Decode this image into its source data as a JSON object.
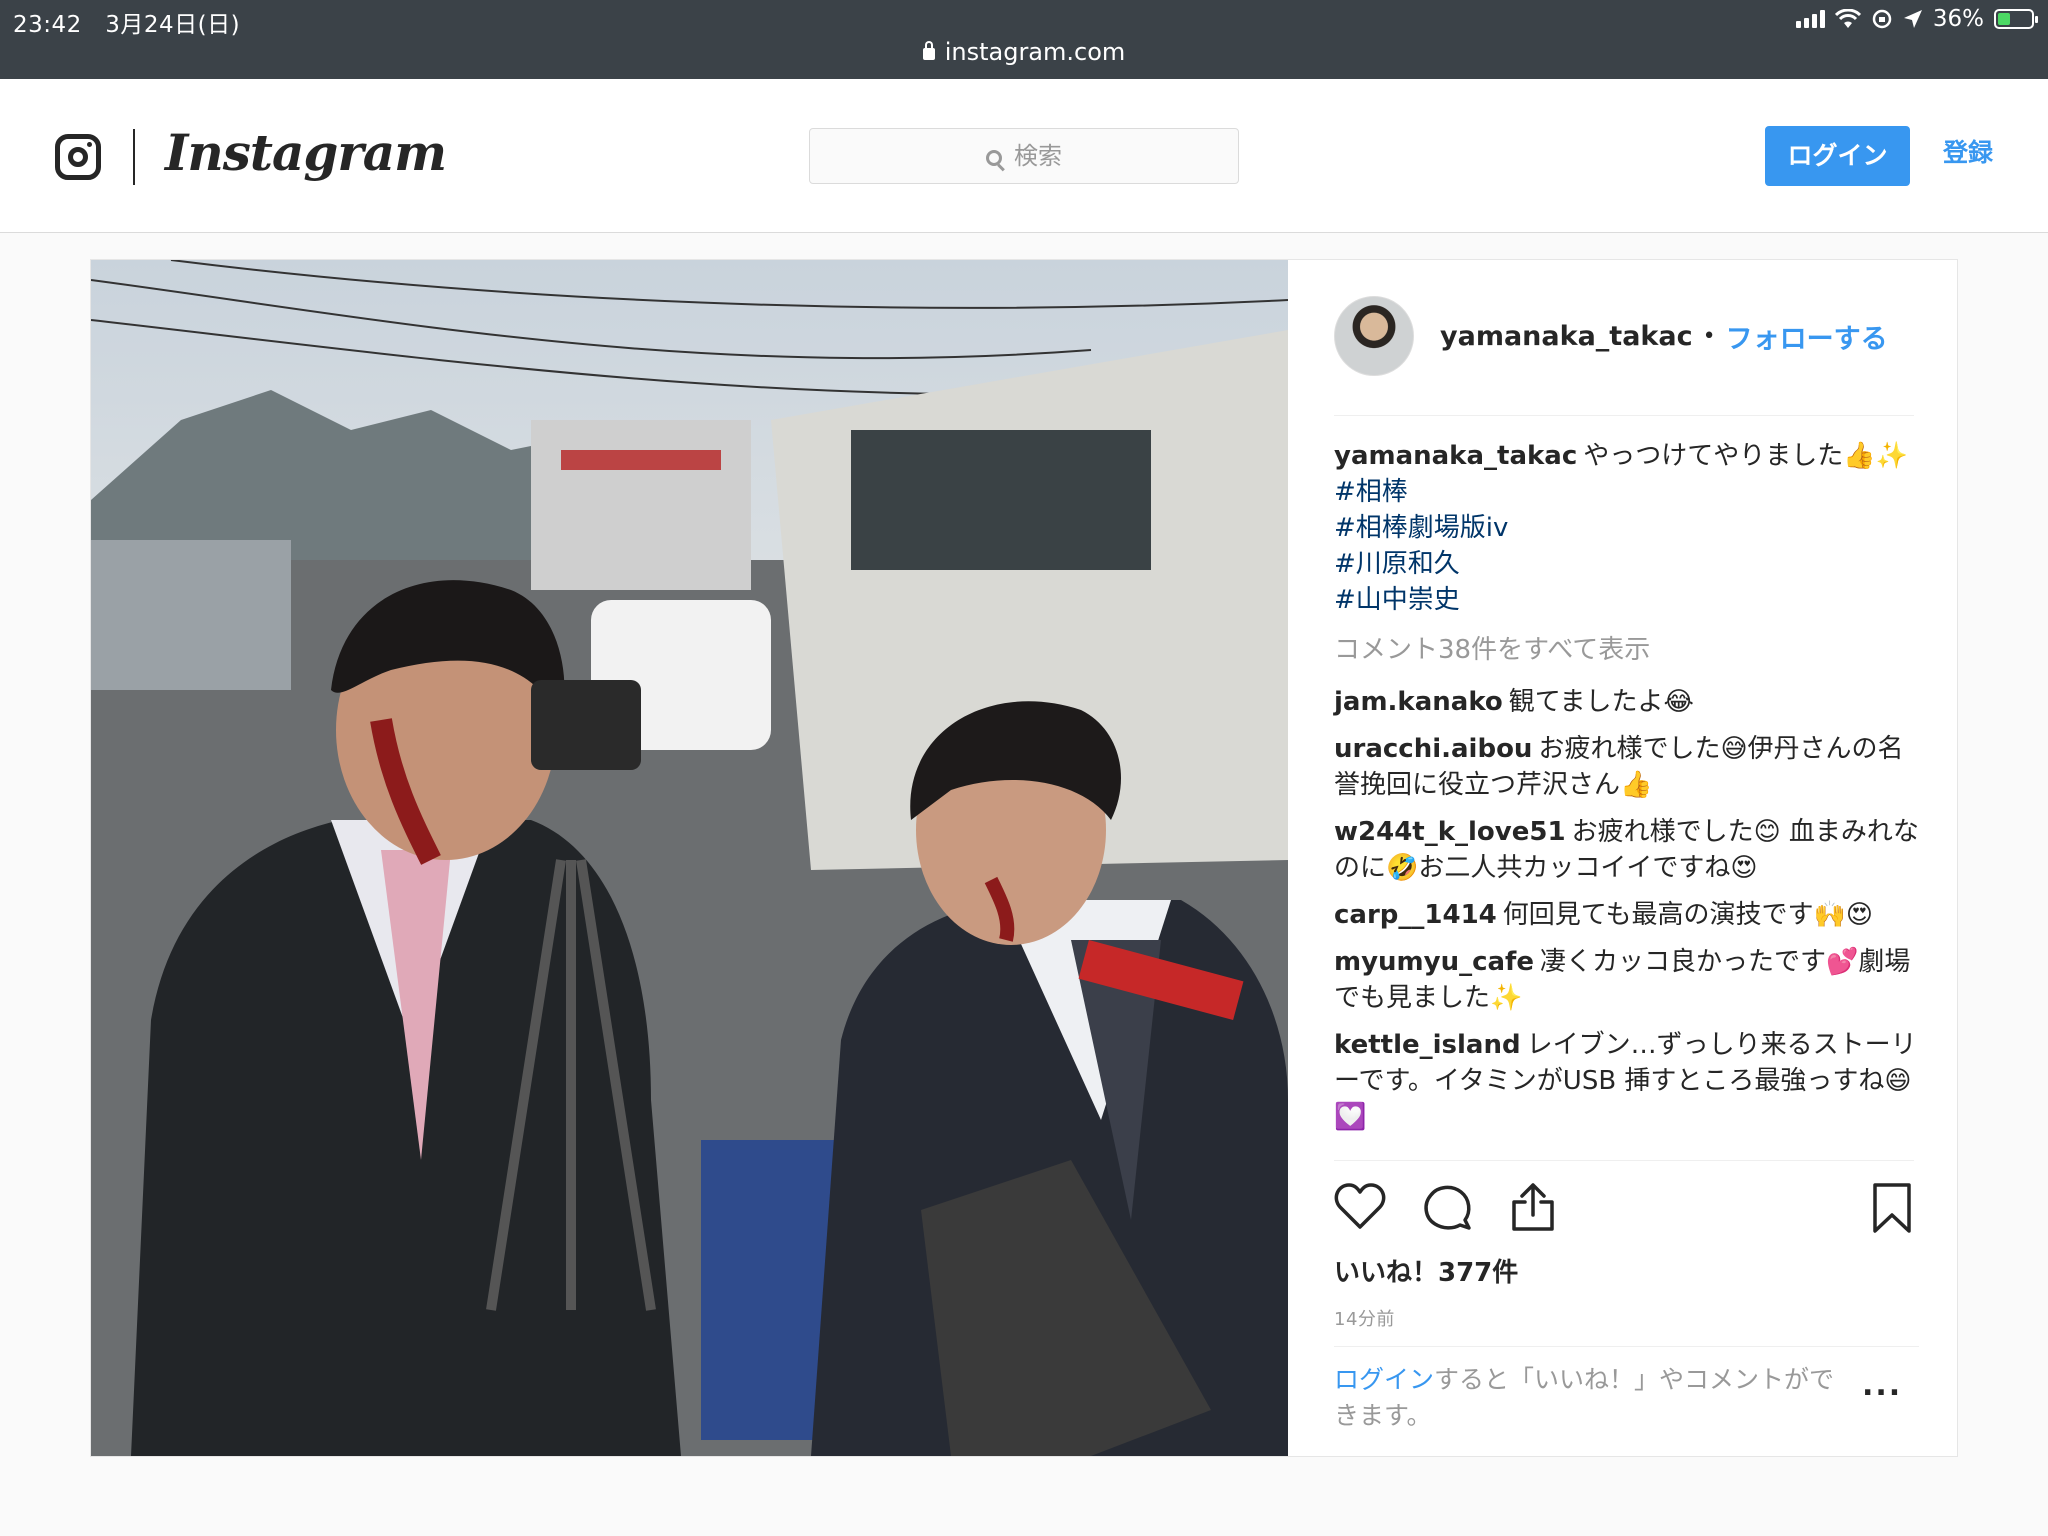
{
  "status_bar": {
    "time": "23:42　3月24日(日)",
    "battery": "36%",
    "battery_level": 0.36,
    "url": "instagram.com"
  },
  "header": {
    "wordmark": "Instagram",
    "search_placeholder": "検索",
    "login_label": "ログイン",
    "signup_label": "登録"
  },
  "post": {
    "author": "yamanaka_takac",
    "separator": "•",
    "follow_label": "フォローする",
    "caption_user": "yamanaka_takac",
    "caption_text": "やっつけてやりました👍✨",
    "hashtags": [
      "#相棒",
      "#相棒劇場版iv",
      "#川原和久",
      "#山中崇史"
    ],
    "view_all_comments": "コメント38件をすべて表示",
    "comments": [
      {
        "user": "jam.kanako",
        "text": "観てましたよ😂"
      },
      {
        "user": "uracchi.aibou",
        "text": "お疲れ様でした😅伊丹さんの名誉挽回に役立つ芹沢さん👍"
      },
      {
        "user": "w244t_k_love51",
        "text": "お疲れ様でした😊 血まみれなのに🤣お二人共カッコイイですね😍"
      },
      {
        "user": "carp__1414",
        "text": "何回見ても最高の演技です🙌😍"
      },
      {
        "user": "myumyu_cafe",
        "text": "凄くカッコ良かったです💕劇場でも見ました✨"
      },
      {
        "user": "kettle_island",
        "text": "レイブン…ずっしり来るストーリーです。イタミンがUSB 挿すところ最強っすね😄💟"
      }
    ],
    "likes": "いいね！377件",
    "time_ago": "14分前",
    "login_prompt_link": "ログイン",
    "login_prompt_rest": "すると「いいね！」やコメントができます。",
    "more_label": "..."
  },
  "icons": {
    "instagram_logo": "camera-glyph-icon",
    "search": "search-icon",
    "like": "heart-icon",
    "comment": "comment-bubble-icon",
    "share": "share-icon",
    "save": "bookmark-icon",
    "lock": "lock-icon"
  },
  "colors": {
    "accent": "#3897f0",
    "hashtag": "#003569",
    "status_bar": "#3b4248"
  }
}
